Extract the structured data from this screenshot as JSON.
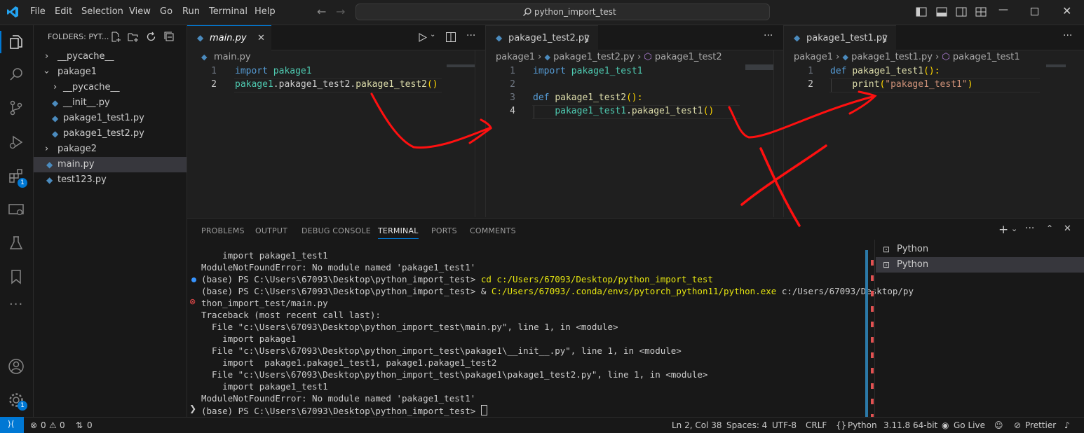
{
  "menu": [
    "File",
    "Edit",
    "Selection",
    "View",
    "Go",
    "Run",
    "Terminal",
    "Help"
  ],
  "search_label": "python_import_test",
  "explorer": {
    "title": "FOLDERS: PYT...",
    "items": [
      "__pycache__",
      "pakage1",
      "__pycache__",
      "__init__.py",
      "pakage1_test1.py",
      "pakage1_test2.py",
      "pakage2",
      "main.py",
      "test123.py"
    ]
  },
  "activity_badges": [
    "1",
    "1"
  ],
  "editor1": {
    "tab": "main.py",
    "breadcrumb": "main.py",
    "line_numbers": [
      "1",
      "2"
    ],
    "lines": [
      [
        "import ",
        "pakage1"
      ],
      [
        "pakage1",
        ".",
        "pakage1_test2",
        ".",
        "pakage1_test2",
        "()"
      ]
    ]
  },
  "editor2": {
    "tab": "pakage1_test2.py",
    "breadcrumb": [
      "pakage1",
      "pakage1_test2.py",
      "pakage1_test2"
    ],
    "line_numbers": [
      "1",
      "2",
      "3",
      "4"
    ],
    "lines": [
      [
        "import ",
        "pakage1_test1"
      ],
      [],
      [
        "def ",
        "pakage1_test2",
        "():"
      ],
      [
        "    ",
        "pakage1_test1",
        ".",
        "pakage1_test1",
        "()"
      ]
    ]
  },
  "editor3": {
    "tab": "pakage1_test1.py",
    "breadcrumb": [
      "pakage1",
      "pakage1_test1.py",
      "pakage1_test1"
    ],
    "line_numbers": [
      "1",
      "2"
    ],
    "lines": [
      [
        "def ",
        "pakage1_test1",
        "():"
      ],
      [
        "    ",
        "print",
        "(",
        "\"pakage1_test1\"",
        ")"
      ]
    ]
  },
  "panel_tabs": [
    "PROBLEMS",
    "OUTPUT",
    "DEBUG CONSOLE",
    "TERMINAL",
    "PORTS",
    "COMMENTS"
  ],
  "terminal": {
    "lines": [
      "    import pakage1_test1",
      "ModuleNotFoundError: No module named 'pakage1_test1'",
      "(base) PS C:\\Users\\67093\\Desktop\\python_import_test> ",
      "(base) PS C:\\Users\\67093\\Desktop\\python_import_test> & ",
      "thon_import_test/main.py",
      "Traceback (most recent call last):",
      "  File \"c:\\Users\\67093\\Desktop\\python_import_test\\main.py\", line 1, in <module>",
      "    import pakage1",
      "  File \"c:\\Users\\67093\\Desktop\\python_import_test\\pakage1\\__init__.py\", line 1, in <module>",
      "    import  pakage1.pakage1_test1, pakage1.pakage1_test2",
      "  File \"c:\\Users\\67093\\Desktop\\python_import_test\\pakage1\\pakage1_test2.py\", line 1, in <module>",
      "    import pakage1_test1",
      "ModuleNotFoundError: No module named 'pakage1_test1'",
      "(base) PS C:\\Users\\67093\\Desktop\\python_import_test> "
    ],
    "cmd_cd": "cd c:/Users/67093/Desktop/python_import_test",
    "cmd_python": "C:/Users/67093/.conda/envs/pytorch_python11/python.exe",
    "cmd_arg": " c:/Users/67093/Desktop/py",
    "sessions": [
      "Python",
      "Python"
    ]
  },
  "status": {
    "errors": "0",
    "warnings": "0",
    "ports": "0",
    "position": "Ln 2, Col 38",
    "spaces": "Spaces: 4",
    "encoding": "UTF-8",
    "eol": "CRLF",
    "language": "Python",
    "interpreter": "3.11.8 64-bit",
    "golive": "Go Live",
    "prettier": "Prettier"
  }
}
